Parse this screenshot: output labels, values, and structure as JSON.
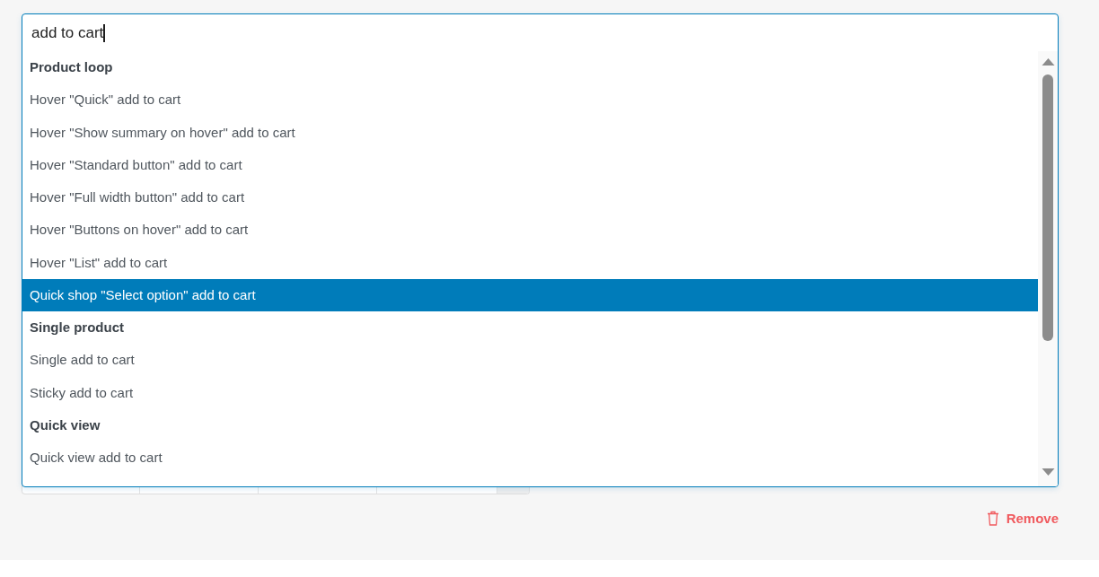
{
  "search": {
    "value": "add to cart"
  },
  "groups": [
    {
      "label": "Product loop",
      "options": [
        {
          "label": "Hover \"Quick\" add to cart",
          "selected": false
        },
        {
          "label": "Hover \"Show summary on hover\" add to cart",
          "selected": false
        },
        {
          "label": "Hover \"Standard button\" add to cart",
          "selected": false
        },
        {
          "label": "Hover \"Full width button\" add to cart",
          "selected": false
        },
        {
          "label": "Hover \"Buttons on hover\" add to cart",
          "selected": false
        },
        {
          "label": "Hover \"List\" add to cart",
          "selected": false
        },
        {
          "label": "Quick shop \"Select option\" add to cart",
          "selected": true
        }
      ]
    },
    {
      "label": "Single product",
      "options": [
        {
          "label": "Single add to cart",
          "selected": false
        },
        {
          "label": "Sticky add to cart",
          "selected": false
        }
      ]
    },
    {
      "label": "Quick view",
      "options": [
        {
          "label": "Quick view add to cart",
          "selected": false
        }
      ]
    }
  ],
  "remove_link": {
    "label": "Remove"
  }
}
